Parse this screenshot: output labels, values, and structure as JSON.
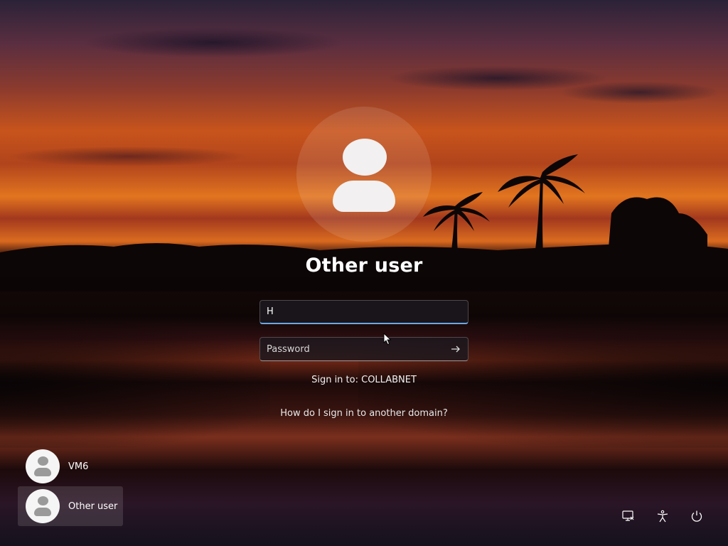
{
  "login": {
    "title": "Other user",
    "username_value": "H",
    "password_placeholder": "Password",
    "submit_icon": "arrow-right-icon",
    "sign_in_to": "Sign in to: COLLABNET",
    "domain_help_link": "How do I sign in to another domain?"
  },
  "users": [
    {
      "name": "VM6",
      "avatar_icon": "user-icon"
    },
    {
      "name": "Other user",
      "avatar_icon": "user-icon",
      "selected": true
    }
  ],
  "tray": {
    "icons": [
      "network-icon",
      "accessibility-icon",
      "power-icon"
    ]
  },
  "colors": {
    "focus_accent": "#6aa9e6",
    "avatar_fill": "#f2f0f0"
  }
}
